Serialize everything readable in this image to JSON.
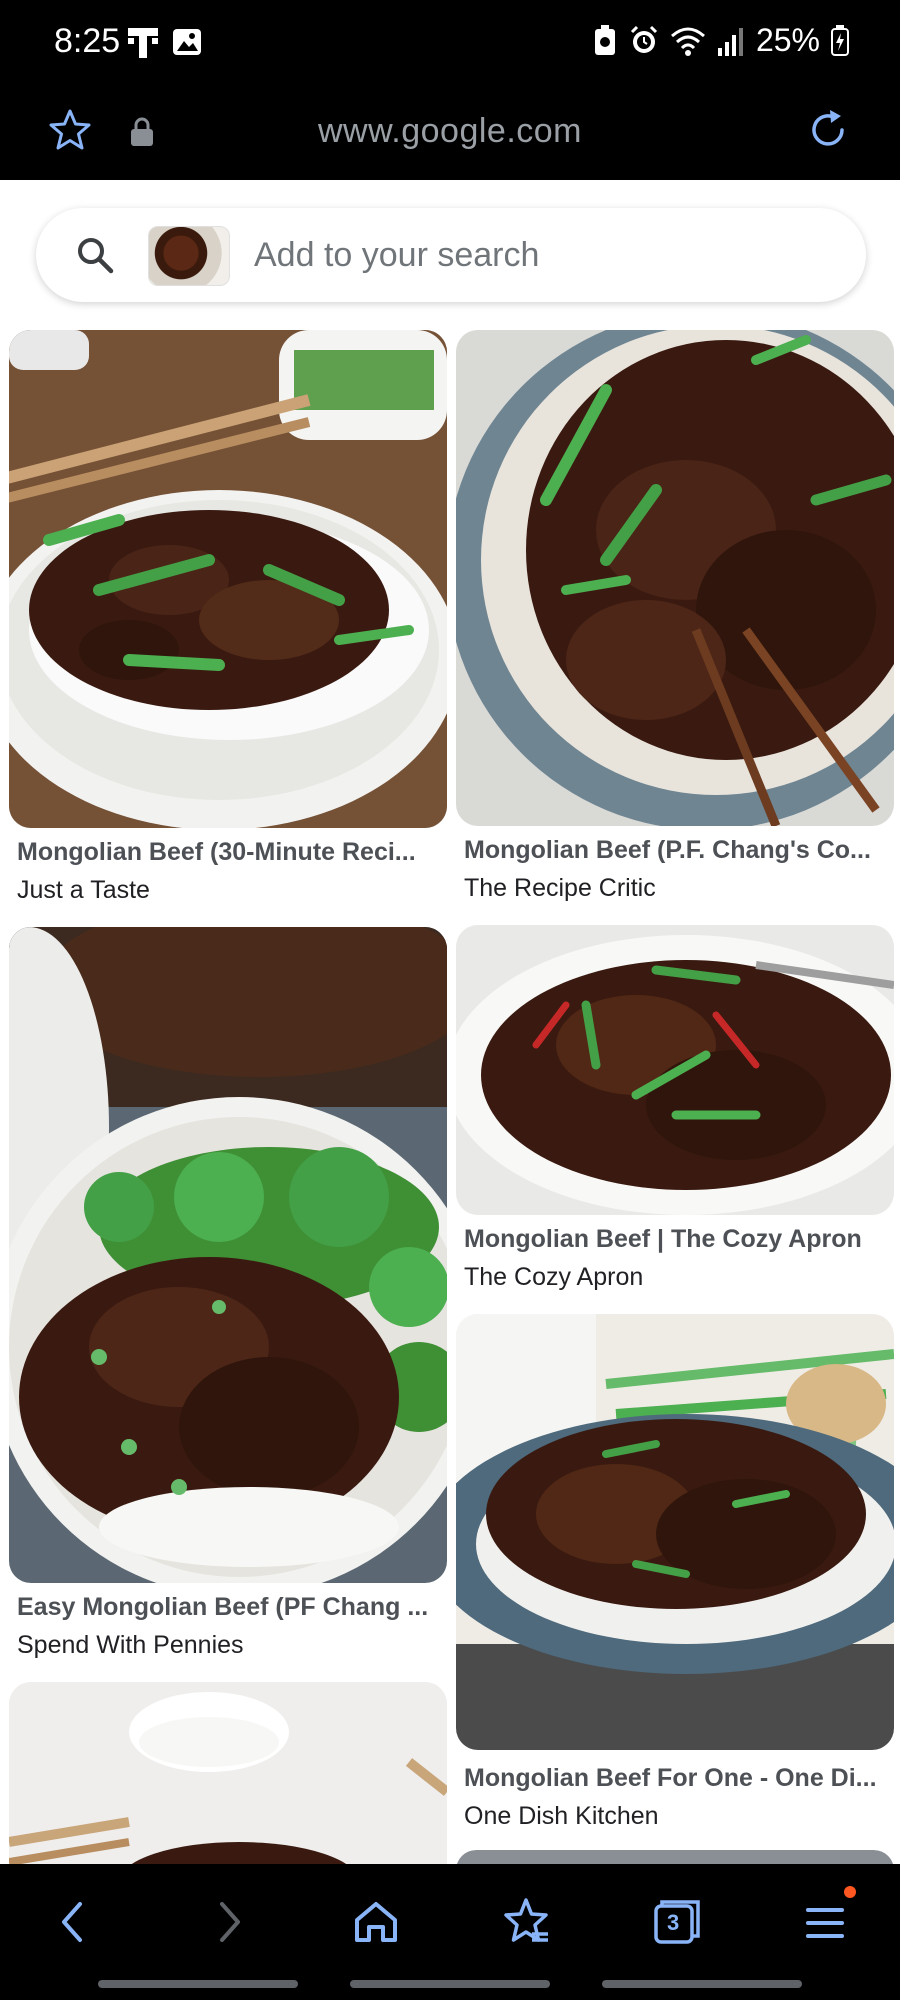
{
  "status_bar": {
    "time": "8:25",
    "carrier_icon": "t-mobile-icon",
    "battery": "25%"
  },
  "url_bar": {
    "url": "www.google.com"
  },
  "search": {
    "placeholder": "Add to your search"
  },
  "results": [
    {
      "title": "Mongolian Beef (30-Minute Reci...",
      "source": "Just a Taste"
    },
    {
      "title": "Mongolian Beef (P.F. Chang's Co...",
      "source": "The Recipe Critic"
    },
    {
      "title": "Easy Mongolian Beef (PF Chang ...",
      "source": "Spend With Pennies"
    },
    {
      "title": "Mongolian Beef | The Cozy Apron",
      "source": "The Cozy Apron"
    },
    {
      "title": "Mongolian Beef For One - One Di...",
      "source": "One Dish Kitchen"
    }
  ],
  "bottom_nav": {
    "tab_count": "3"
  },
  "colors": {
    "accent": "#8ab4f8",
    "notification_dot": "#ff5722"
  }
}
